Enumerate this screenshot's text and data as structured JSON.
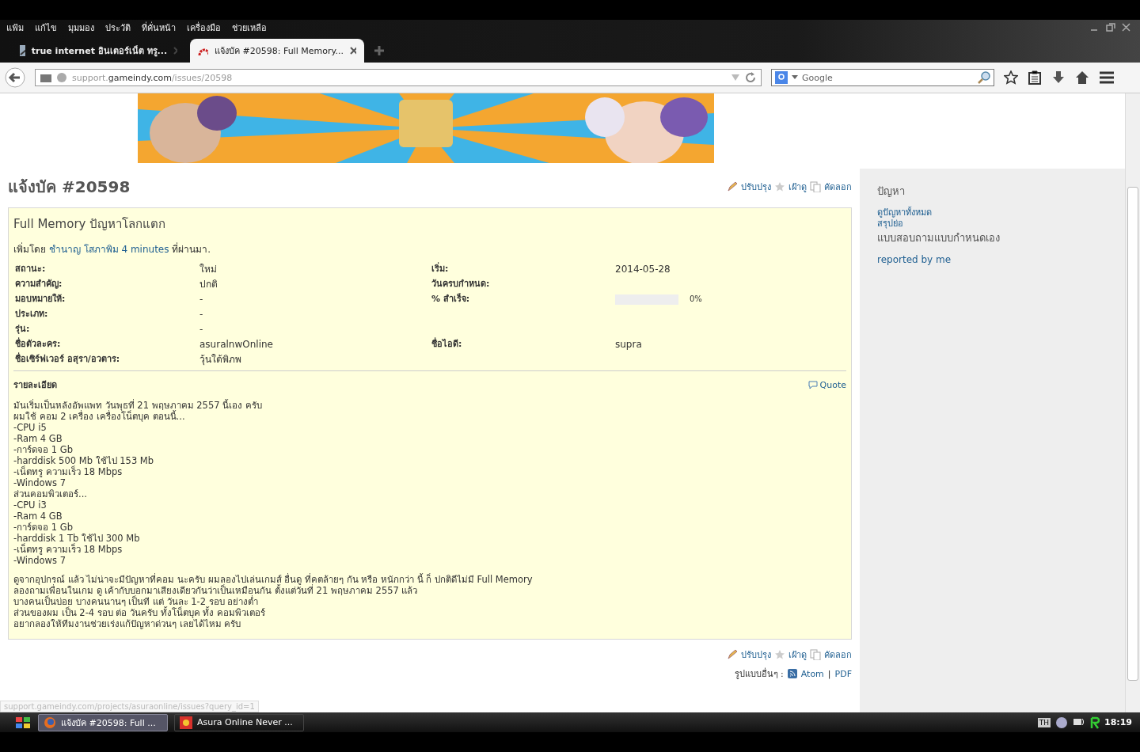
{
  "menu": [
    "แฟ้ม",
    "แก้ไข",
    "มุมมอง",
    "ประวัติ",
    "ที่คั่นหน้า",
    "เครื่องมือ",
    "ช่วยเหลือ"
  ],
  "tabs": [
    {
      "title": "true internet อินเตอร์เน็ต ทรู...",
      "selected": false
    },
    {
      "title": "แจ้งบัค #20598: Full Memory...",
      "selected": true
    }
  ],
  "address": {
    "prefix": "support.",
    "host": "gameindy.com",
    "path": "/issues/20598"
  },
  "search": {
    "placeholder": "Google"
  },
  "issue": {
    "heading": "แจ้งบัค #20598",
    "actions": [
      "ปรับปรุง",
      "เฝ้าดู",
      "คัดลอก"
    ],
    "subject": "Full Memory ปัญหาโลกแตก",
    "added": {
      "prefix": "เพิ่มโดย",
      "author": "ชำนาญ โสภาพิม",
      "age": "4 minutes",
      "suffix": "ที่ผ่านมา."
    },
    "attributes": [
      [
        {
          "label": "สถานะ:",
          "value": "ใหม่"
        },
        {
          "label": "เริ่ม:",
          "value": "2014-05-28"
        }
      ],
      [
        {
          "label": "ความสำคัญ:",
          "value": "ปกติ"
        },
        {
          "label": "วันครบกำหนด:"
        }
      ],
      [
        {
          "label": "มอบหมายให้:",
          "value": "-"
        },
        {
          "label": "% สำเร็จ:",
          "kind": "progress",
          "level": 0,
          "reading": "0%"
        }
      ],
      [
        {
          "label": "ประเภท:",
          "value": "-"
        }
      ],
      [
        {
          "label": "รุ่น:",
          "value": "-"
        }
      ],
      [
        {
          "label": "ชื่อตัวละคร:",
          "value": "asuralnwOnline"
        },
        {
          "label": "ชื่อไอดี:",
          "value": "supra"
        }
      ],
      [
        {
          "label": "ชื่อเซิร์ฟเวอร์ อสุรา/อวตาร:",
          "value": "วุ้นใต้พิภพ"
        }
      ]
    ],
    "description_title": "รายละเอียด",
    "quote": "Quote",
    "description": [
      [
        "มันเริ่มเป็นหลังอัพแพท วันพุธที่ 21 พฤษภาคม 2557 นี้เอง ครับ",
        "ผมใช้ คอม 2 เครื่อง เครื่องโน็ตบุค ตอนนี้...",
        "-CPU i5",
        "-Ram 4 GB",
        "-การ์ดจอ 1 Gb",
        "-harddisk 500 Mb ใช้ไป 153 Mb",
        "-เน็ตทรู ความเร็ว 18 Mbps",
        "-Windows 7",
        "ส่วนคอมพิวเตอร์...",
        "-CPU i3",
        "-Ram 4 GB",
        "-การ์ดจอ 1 Gb",
        "-harddisk 1 Tb ใช้ไป 300 Mb",
        "-เน็ตทรู ความเร็ว 18 Mbps",
        "-Windows 7"
      ],
      [
        "ดูจากอุปกรณ์ แล้ว ไม่น่าจะมีปัญหาที่คอม นะครับ ผมลองไปเล่นเกมส์ อื่นดู ที่คตล้ายๆ กัน หรือ หนักกว่า นี้ ก็ ปกติดีไม่มี Full Memory",
        "ลองถามเพื่อนในเกม ดู เค้ากับบอกมาเสียงเดียวกันว่าเป็นเหมือนกัน ตั้งแต่วันที่ 21 พฤษภาคม 2557 แล้ว",
        "บางคนเป็นบ่อย บางคนนานๆ เป็นที แต่ วันละ 1-2 รอบ อย่างต่ำ",
        "ส่วนของผม เป็น 2-4 รอบ ต่อ วันครับ ทั้งโน็ตบุค ทั้ง คอมพิวเตอร์",
        "อยากลองให้ทีมงานช่วยเร่งแก้ปัญหาด่วนๆ เลยได้ไหม ครับ"
      ]
    ],
    "bottom_actions": [
      "ปรับปรุง",
      "เฝ้าดู",
      "คัดลอก"
    ],
    "formats": {
      "label": "รูปแบบอื่นๆ :",
      "links": [
        "Atom",
        "PDF"
      ],
      "separator": "|"
    }
  },
  "sidebar": {
    "title": "ปัญหา",
    "links": [
      "ดูปัญหาทั้งหมด",
      "สรุปย่อ"
    ],
    "queries_title": "แบบสอบถามแบบกำหนดเอง",
    "queries": [
      "reported by me"
    ]
  },
  "status_url": "support.gameindy.com/projects/asuraonline/issues?query_id=1",
  "taskbar": {
    "items": [
      {
        "title": "แจ้งบัค #20598: Full ...",
        "selected": true
      },
      {
        "title": "Asura Online Never ...",
        "selected": false
      }
    ],
    "lang": "TH",
    "time": "18:19"
  }
}
